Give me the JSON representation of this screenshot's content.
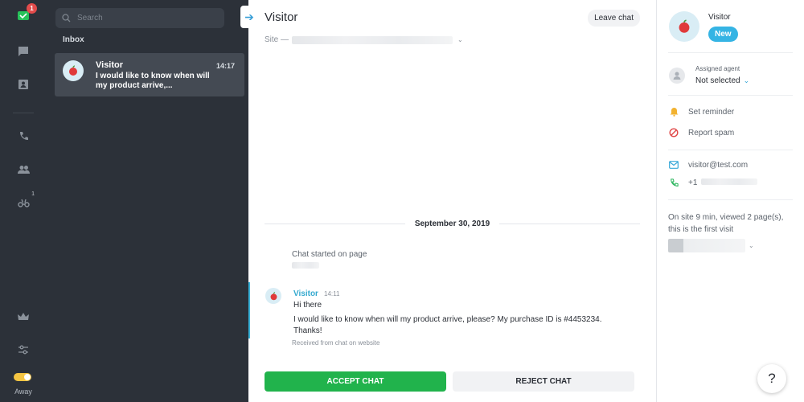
{
  "rail": {
    "chats_badge": "1",
    "traffic_badge": "1",
    "status_label": "Away"
  },
  "list": {
    "search_placeholder": "Search",
    "section_label": "Inbox",
    "conversation": {
      "name": "Visitor",
      "time": "14:17",
      "preview": "I would like to know when will my product arrive,..."
    }
  },
  "chat": {
    "title": "Visitor",
    "leave_label": "Leave chat",
    "site_label": "Site —",
    "date_divider": "September 30, 2019",
    "started_label": "Chat started on page",
    "message": {
      "author": "Visitor",
      "time": "14:11",
      "line1": "Hi there",
      "line2": "I would like to know when will my product arrive, please? My purchase ID is #4453234. Thanks!",
      "footer": "Received from chat on website"
    },
    "accept_label": "ACCEPT CHAT",
    "reject_label": "REJECT CHAT"
  },
  "details": {
    "visitor_name": "Visitor",
    "status_badge": "New",
    "assigned_label": "Assigned agent",
    "assigned_value": "Not selected",
    "set_reminder": "Set reminder",
    "report_spam": "Report spam",
    "email": "visitor@test.com",
    "phone_prefix": "+1",
    "visit_info": "On site 9 min, viewed 2 page(s), this is the first visit"
  },
  "help_label": "?",
  "colors": {
    "accent": "#35b4e4",
    "accept": "#21b34c",
    "sidebar": "#2c3139"
  }
}
